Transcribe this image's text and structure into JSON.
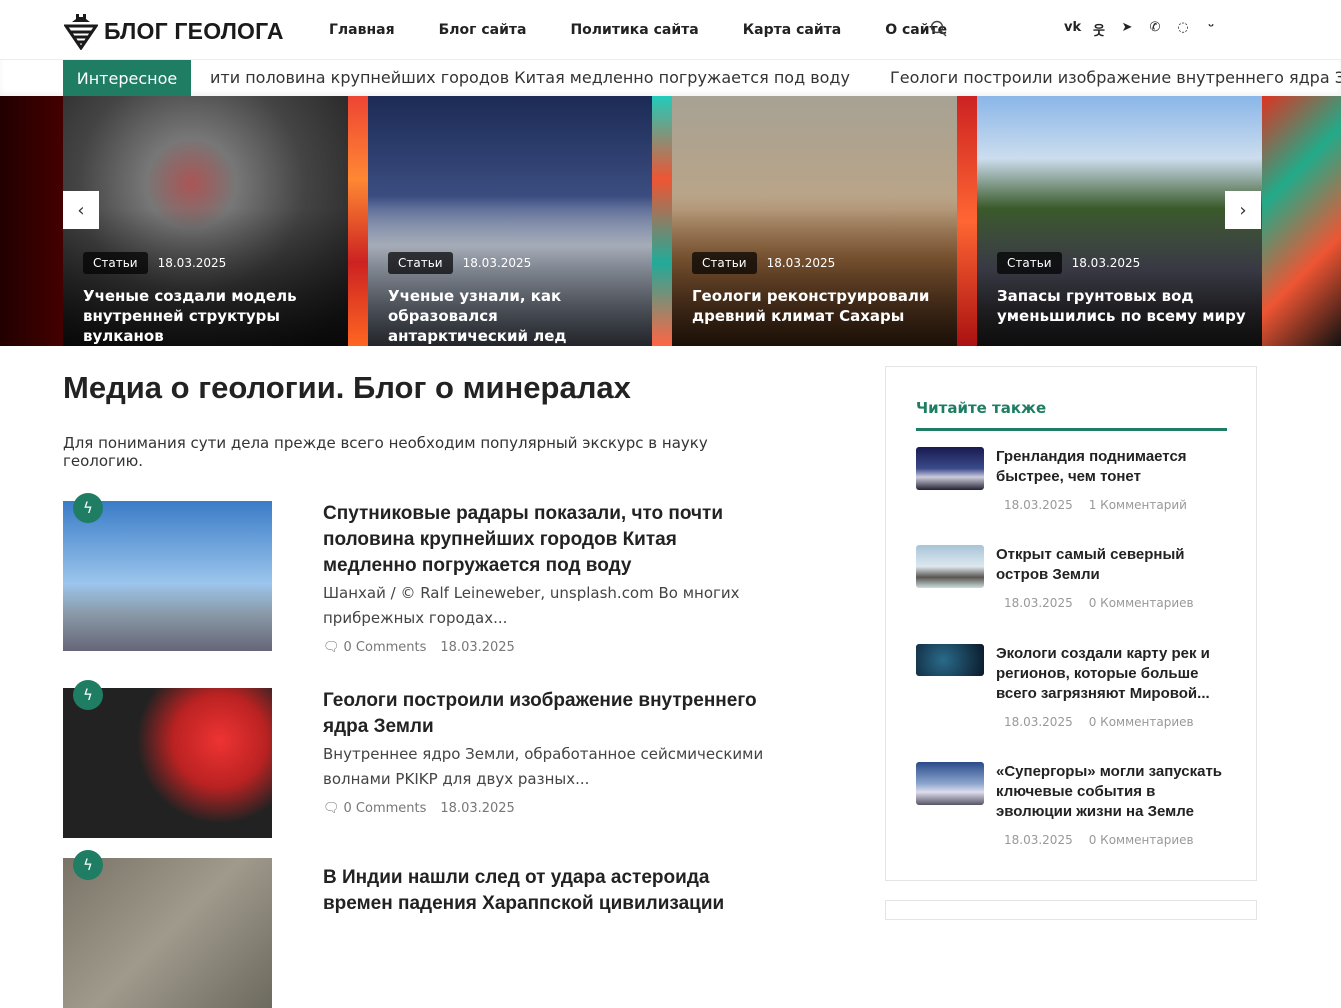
{
  "header": {
    "logo": "БЛОГ ГЕОЛОГА",
    "nav": [
      "Главная",
      "Блог сайта",
      "Политика сайта",
      "Карта сайта",
      "О сайте"
    ],
    "social": [
      "vk-icon",
      "ok-icon",
      "telegram-icon",
      "viber-icon",
      "whatsapp-icon",
      "max-icon"
    ]
  },
  "ticker": {
    "label": "Интересное",
    "items": [
      "ити половина крупнейших городов Китая медленно погружается под воду",
      "Геологи построили изображение внутреннего ядра Земли"
    ]
  },
  "slider": [
    {
      "category": "Статьи",
      "date": "18.03.2025",
      "title": "Ученые создали модель внутренней структуры вулканов"
    },
    {
      "category": "Статьи",
      "date": "18.03.2025",
      "title": "Ученые узнали, как образовался антарктический лед"
    },
    {
      "category": "Статьи",
      "date": "18.03.2025",
      "title": "Геологи реконструировали древний климат Сахары"
    },
    {
      "category": "Статьи",
      "date": "18.03.2025",
      "title": "Запасы грунтовых вод уменьшились по всему миру"
    }
  ],
  "main": {
    "title": "Медиа о геологии. Блог о минералах",
    "intro": "Для понимания сути дела прежде всего необходим популярный экскурс в науку геологию.",
    "posts": [
      {
        "title": "Спутниковые радары показали, что почти половина крупнейших городов Китая медленно погружается под воду",
        "excerpt": "Шанхай / © Ralf Leineweber, unsplash.com Во многих прибрежных городах...",
        "comments": "0 Comments",
        "date": "18.03.2025"
      },
      {
        "title": "Геологи построили изображение внутреннего ядра Земли",
        "excerpt": "Внутреннее ядро Земли, обработанное сейсмическими волнами PKIKP для двух разных...",
        "comments": "0 Comments",
        "date": "18.03.2025"
      },
      {
        "title": "В Индии нашли след от удара астероида времен падения Хараппской цивилизации",
        "excerpt": "",
        "comments": "",
        "date": ""
      }
    ]
  },
  "sidebar": {
    "title": "Читайте также",
    "items": [
      {
        "title": "Гренландия поднимается быстрее, чем тонет",
        "date": "18.03.2025",
        "comments": "1 Комментарий"
      },
      {
        "title": "Открыт самый северный остров Земли",
        "date": "18.03.2025",
        "comments": "0 Комментариев"
      },
      {
        "title": "Экологи создали карту рек и регионов, которые больше всего загрязняют Мировой...",
        "date": "18.03.2025",
        "comments": "0 Комментариев"
      },
      {
        "title": "«Супергоры» могли запускать ключевые события в эволюции жизни на Земле",
        "date": "18.03.2025",
        "comments": "0 Комментариев"
      }
    ]
  },
  "colors": {
    "accent": "#1e7d62"
  }
}
